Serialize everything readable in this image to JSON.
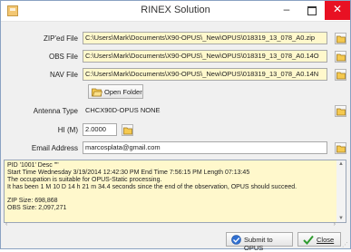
{
  "window": {
    "title": "RINEX Solution",
    "minimize_glyph": "–",
    "close_glyph": "✕"
  },
  "form": {
    "zip_label": "ZIP'ed File",
    "zip_value": "C:\\Users\\Mark\\Documents\\X90-OPUS\\_New\\OPUS\\018319_13_078_A0.zip",
    "obs_label": "OBS File",
    "obs_value": "C:\\Users\\Mark\\Documents\\X90-OPUS\\_New\\OPUS\\018319_13_078_A0.14O",
    "nav_label": "NAV File",
    "nav_value": "C:\\Users\\Mark\\Documents\\X90-OPUS\\_New\\OPUS\\018319_13_078_A0.14N",
    "open_folder_label": "Open Folder",
    "antenna_label": "Antenna Type",
    "antenna_value": "CHCX90D-OPUS    NONE",
    "hi_label": "HI (M)",
    "hi_value": "2.0000",
    "email_label": "Email Address",
    "email_value": "marcosplata@gmail.com"
  },
  "log": {
    "lines": [
      "PID '1001'  Desc \"\"",
      "Start Time Wednesday 3/19/2014 12:42:30 PM  End Time 7:56:15 PM  Length 07:13:45",
      "The occupation is suitable for OPUS-Static processing.",
      "It has been 1 M 10 D 14 h 21 m 34.4 seconds since the end of the observation, OPUS should succeed.",
      "",
      "ZIP Size: 698,868",
      "OBS Size: 2,097,271"
    ]
  },
  "buttons": {
    "submit_label": "Submit to OPUS",
    "close_label": "Close"
  },
  "colors": {
    "field_highlight": "#fff8cc",
    "close_button": "#e81123"
  },
  "icons": {
    "app": "app-icon",
    "folder": "folder-icon",
    "submit": "globe-icon",
    "close": "checkmark-icon"
  }
}
